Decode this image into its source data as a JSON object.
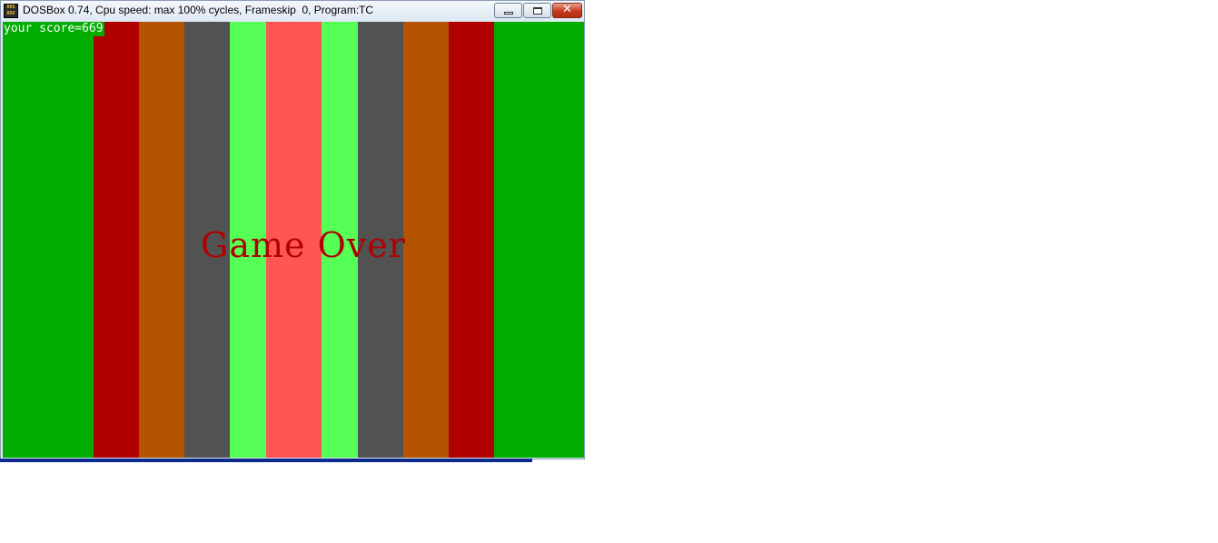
{
  "window": {
    "title": "DOSBox 0.74, Cpu speed: max 100% cycles, Frameskip  0, Program:",
    "program": "TC",
    "icon": "dosbox-icon",
    "icon_text": "DOS BOX",
    "buttons": {
      "minimize_icon": "minimize-icon",
      "maximize_icon": "maximize-icon",
      "close_icon": "close-icon",
      "close_glyph": "✕"
    }
  },
  "game": {
    "score_text": "your score=669",
    "game_over_text": "Game Over",
    "colors": {
      "game_over": "#b10000",
      "score_text": "#ffffff"
    },
    "stripes": [
      {
        "color": "#00ad00"
      },
      {
        "color": "#b00000"
      },
      {
        "color": "#b45300"
      },
      {
        "color": "#525252"
      },
      {
        "color": "#55ff55"
      },
      {
        "color": "#ff5555"
      },
      {
        "color": "#55ff55"
      },
      {
        "color": "#525252"
      },
      {
        "color": "#b45300"
      },
      {
        "color": "#b00000"
      },
      {
        "color": "#00ad00"
      }
    ]
  }
}
